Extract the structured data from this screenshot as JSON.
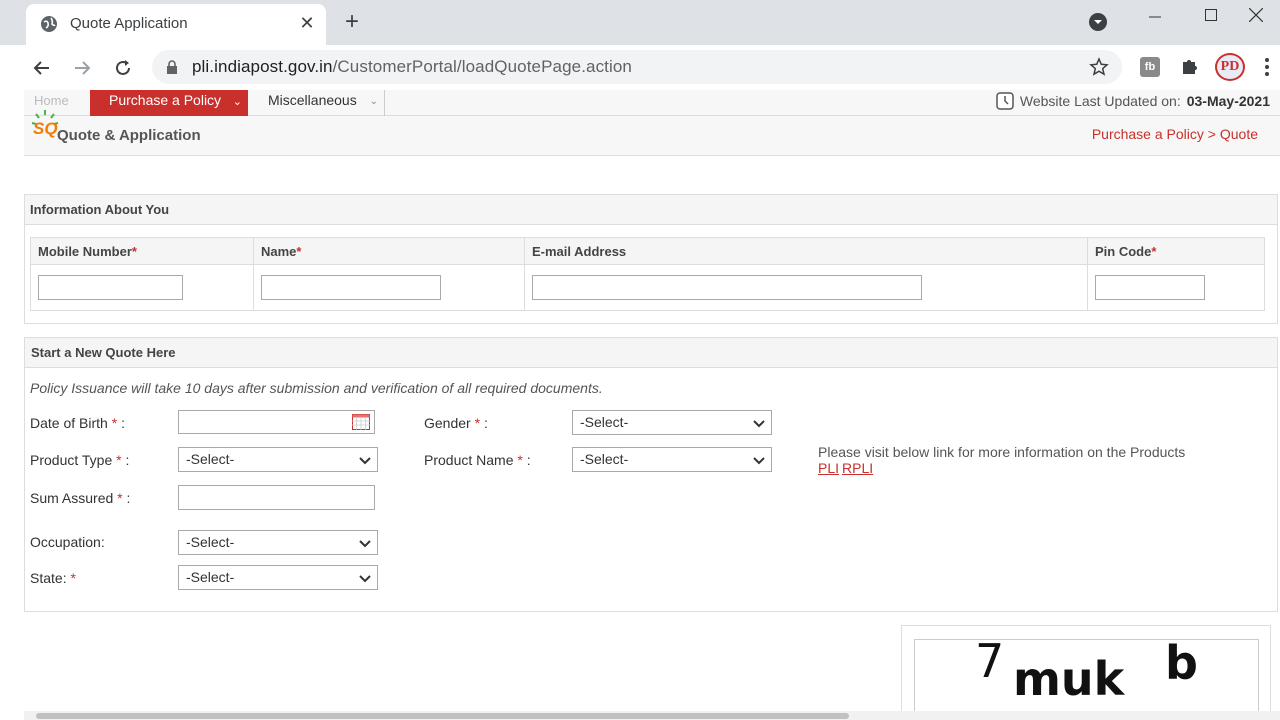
{
  "browser": {
    "tab_title": "Quote Application",
    "url_host": "pli.indiapost.gov.in",
    "url_path": "/CustomerPortal/loadQuotePage.action",
    "profile_initials": "PD",
    "extension_label": "fb"
  },
  "menu": {
    "home": "Home",
    "purchase": "Purchase a Policy",
    "misc": "Miscellaneous",
    "updated_prefix": "Website Last Updated on:",
    "updated_date": "03-May-2021"
  },
  "header": {
    "logo_text": "SQ",
    "title": "Quote & Application",
    "crumb_1": "Purchase a Policy",
    "crumb_sep": ">",
    "crumb_2": "Quote"
  },
  "info_section": {
    "heading": "Information About You",
    "col_mobile": "Mobile Number",
    "col_name": "Name",
    "col_email": "E-mail Address",
    "col_pin": "Pin Code",
    "required_mark": "*"
  },
  "quote_section": {
    "heading": "Start a New Quote Here",
    "note": "Policy Issuance will take 10 days after submission and verification of all required documents.",
    "dob_label": "Date of Birth",
    "gender_label": "Gender",
    "product_type_label": "Product Type",
    "product_name_label": "Product Name",
    "sum_assured_label": "Sum Assured",
    "occupation_label": "Occupation:",
    "state_label": "State:",
    "colon": ":",
    "select_default": "-Select-",
    "products_info": "Please visit below link for more information on the Products",
    "link_pli": "PLI",
    "link_rpli": "RPLI"
  },
  "captcha": {
    "text_1": "7",
    "text_2": "muk",
    "text_3": "b"
  },
  "colors": {
    "accent": "#c9302c",
    "chrome_bg": "#dee1e6"
  }
}
